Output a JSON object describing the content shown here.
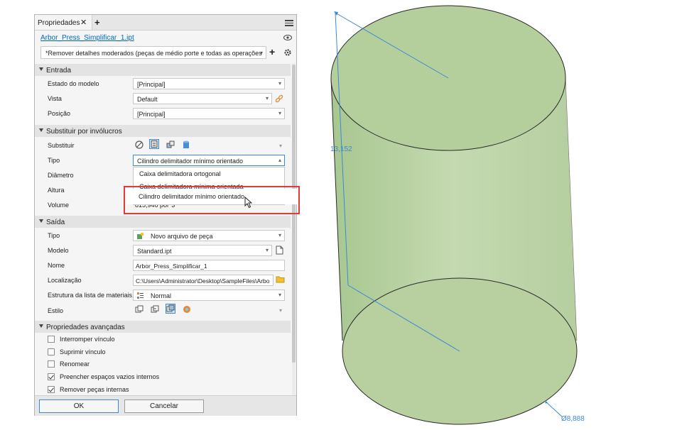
{
  "panel": {
    "tab_title": "Propriedades",
    "file_name": "Arbor_Press_Simplificar_1.ipt",
    "preset_value": "*Remover detalhes moderados (peças de médio porte e todas as operações"
  },
  "entrada": {
    "header": "Entrada",
    "estado_label": "Estado do modelo",
    "estado_value": "[Principal]",
    "vista_label": "Vista",
    "vista_value": "Default",
    "posicao_label": "Posição",
    "posicao_value": "[Principal]"
  },
  "substituir": {
    "header": "Substituir por invólucros",
    "substituir_label": "Substituir",
    "tipo_label": "Tipo",
    "tipo_value": "Cilindro delimitador mínimo orientado",
    "diametro_label": "Diâmetro",
    "altura_label": "Altura",
    "volume_label": "Volume",
    "volume_value": "815,946 pol^3",
    "options": [
      "Caixa delimitadora ortogonal",
      "Caixa delimitadora mínima orientada",
      "Cilindro delimitador mínimo orientado"
    ]
  },
  "saida": {
    "header": "Saída",
    "tipo_label": "Tipo",
    "tipo_value": "Novo arquivo de peça",
    "modelo_label": "Modelo",
    "modelo_value": "Standard.ipt",
    "nome_label": "Nome",
    "nome_value": "Arbor_Press_Simplificar_1",
    "localizacao_label": "Localização",
    "localizacao_value": "C:\\Users\\Administrator\\Desktop\\SampleFiles\\Arbo",
    "estrutura_label": "Estrutura da lista de materiais",
    "estrutura_value": "Normal",
    "estilo_label": "Estilo"
  },
  "avancadas": {
    "header": "Propriedades avançadas",
    "checks": [
      {
        "label": "Interromper vínculo",
        "checked": false
      },
      {
        "label": "Suprimir vínculo",
        "checked": false
      },
      {
        "label": "Renomear",
        "checked": false
      },
      {
        "label": "Preencher espaços vazios internos",
        "checked": true
      },
      {
        "label": "Remover peças internas",
        "checked": true
      }
    ]
  },
  "buttons": {
    "ok": "OK",
    "cancel": "Cancelar"
  },
  "viewport": {
    "height_dim": "13,152",
    "diameter_dim": "Ø8,888",
    "cylinder_color": "#b4cf9c",
    "dim_color": "#3c8ad4"
  }
}
